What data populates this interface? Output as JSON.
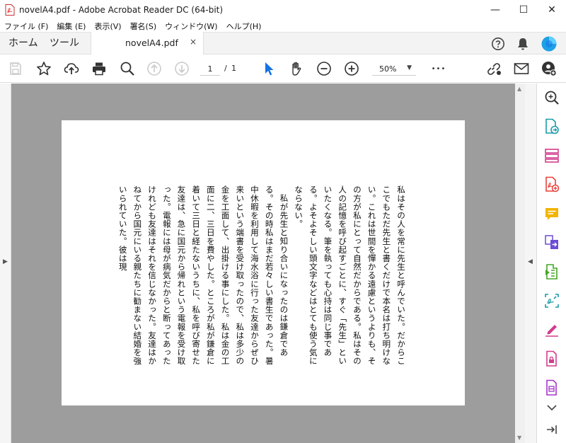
{
  "window": {
    "title": "novelA4.pdf - Adobe Acrobat Reader DC (64-bit)",
    "minimize": "—",
    "maximize": "☐",
    "close": "✕"
  },
  "menu": [
    "ファイル (F)",
    "編集 (E)",
    "表示(V)",
    "署名(S)",
    "ウィンドウ(W)",
    "ヘルプ(H)"
  ],
  "tabs": {
    "home": "ホーム",
    "tools": "ツール",
    "document": "novelA4.pdf",
    "close": "×"
  },
  "toolbar": {
    "page_current": "1",
    "page_sep": "/",
    "page_total": "1",
    "zoom": "50%",
    "more": "•••"
  },
  "document": {
    "paragraphs": [
      "私はその人を常に先生と呼んでいた。だからここでもただ先生と書くだけで本名は打ち明けない。これは世間を憚かる遠慮というよりも、その方が私にとって自然だからである。私はその人の記憶を呼び起すごとに、すぐ「先生」といいたくなる。筆を執っても心持は同じ事である。よそよそしい頭文字などはとても使う気にならない。",
      "私が先生と知り合いになったのは鎌倉である。その時私はまだ若々しい書生であった。暑中休暇を利用して海水浴に行った友達からぜひ来いという端書を受け取ったので、私は多少の金を工面して、出掛ける事にした。私は金の工面に二、三日を費やした。ところが私が鎌倉に着いて三日と経たないうちに、私を呼び寄せた友達は、急に国元から帰れという電報を受け取った。電報には母が病気だからと断ってあったけれども友達はそれを信じなかった。友達はかねてから国元にいる親たちに勧まない結婚を強いられていた。彼は現"
    ]
  },
  "colors": {
    "accent_blue": "#1473e6",
    "acrobat_red": "#e8423d",
    "viewer_gray": "#9d9d9d"
  }
}
